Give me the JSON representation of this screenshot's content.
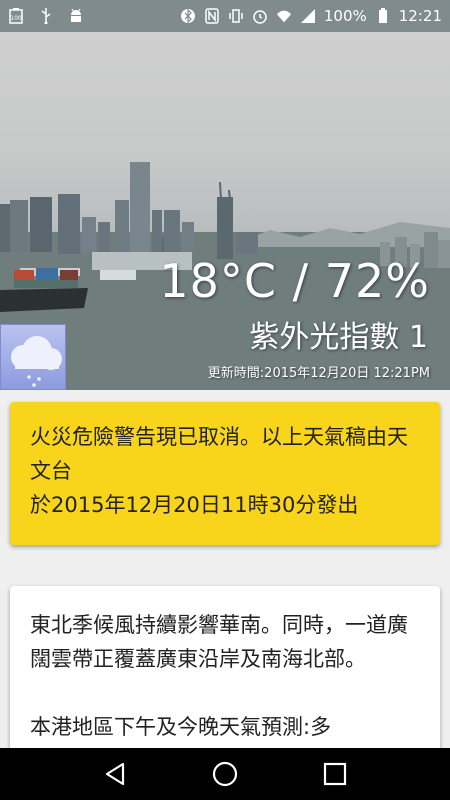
{
  "status_bar": {
    "left_icons": [
      "battery-100-icon",
      "usb-icon",
      "android-debug-icon"
    ],
    "right_icons": [
      "bluetooth-icon",
      "nfc-icon",
      "vibrate-icon",
      "alarm-icon",
      "wifi-icon",
      "signal-icon"
    ],
    "battery": "100%",
    "time": "12:21"
  },
  "hero": {
    "temperature_humidity": "18°C / 72%",
    "uv_index": "紫外光指數 1",
    "updated": "更新時間:2015年12月20日 12:21PM",
    "weather_icon": "cloudy-rain-icon"
  },
  "warning_card": {
    "line1": "火災危險警告現已取消。以上天氣稿由天文台",
    "line2": "於2015年12月20日11時30分發出"
  },
  "forecast_card": {
    "para1": "東北季候風持續影響華南。同時，一道廣闊雲帶正覆蓋廣東沿岸及南海北部。",
    "para2": "本港地區下午及今晚天氣預測:多"
  },
  "nav_bar": {
    "back": "back-icon",
    "home": "home-icon",
    "recents": "recents-icon"
  },
  "colors": {
    "status_bar": "#7f8b8d",
    "warning_card": "#f8d51b",
    "nav_bar": "#000000"
  }
}
